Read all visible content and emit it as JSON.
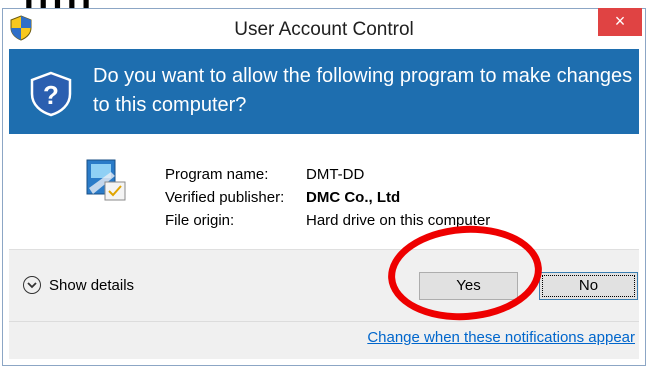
{
  "page": {
    "title": "[[[[["
  },
  "window": {
    "title": "User Account Control",
    "close_label": "×"
  },
  "header": {
    "question": "Do you want to allow the following program to make changes to this computer?"
  },
  "program": {
    "name_label": "Program name:",
    "name_value": "DMT-DD",
    "publisher_label": "Verified publisher:",
    "publisher_value": "DMC Co., Ltd",
    "origin_label": "File origin:",
    "origin_value": "Hard drive on this computer"
  },
  "footer": {
    "show_details_label": "Show details",
    "yes_label": "Yes",
    "no_label": "No",
    "change_link": "Change when these notifications appear"
  },
  "icons": {
    "title_icon": "uac-shield-icon",
    "header_icon": "shield-question-icon",
    "program_icon": "program-icon",
    "details_icon": "chevron-down-circle-icon"
  },
  "colors": {
    "header_bg": "#1e6eaf",
    "close_bg": "#e04343",
    "link": "#0066cc",
    "highlight": "#ee0000"
  }
}
